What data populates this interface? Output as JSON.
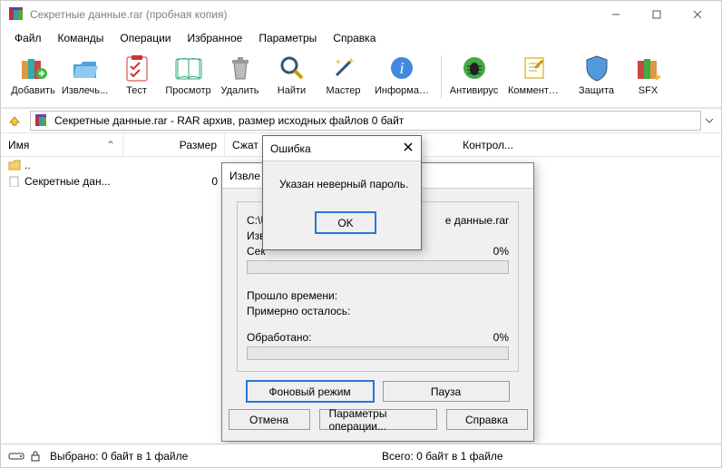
{
  "window": {
    "title": "Секретные данные.rar (пробная копия)"
  },
  "menu": {
    "file": "Файл",
    "commands": "Команды",
    "operations": "Операции",
    "favorites": "Избранное",
    "options": "Параметры",
    "help": "Справка"
  },
  "toolbar": {
    "add": "Добавить",
    "extract": "Извлечь...",
    "test": "Тест",
    "view": "Просмотр",
    "delete": "Удалить",
    "find": "Найти",
    "wizard": "Мастер",
    "info": "Информация",
    "antivirus": "Антивирус",
    "comment": "Комментарий",
    "protect": "Защита",
    "sfx": "SFX"
  },
  "address": {
    "text": "Секретные данные.rar - RAR архив, размер исходных файлов 0 байт"
  },
  "columns": {
    "name": "Имя",
    "size": "Размер",
    "packed": "Сжат",
    "crc": "Контрол..."
  },
  "rows": {
    "updir": "..",
    "file1_name": "Секретные дан...",
    "file1_size": "0"
  },
  "extract_dialog": {
    "title": "Извле",
    "path": "C:\\U",
    "line2_prefix": "Изв",
    "line3_prefix": "Сек",
    "path_tail": "е данные.rar",
    "percent1": "0%",
    "elapsed": "Прошло времени:",
    "remaining": "Примерно осталось:",
    "processed": "Обработано:",
    "percent2": "0%",
    "btn_background": "Фоновый режим",
    "btn_pause": "Пауза",
    "btn_cancel": "Отмена",
    "btn_mode": "Параметры операции...",
    "btn_help": "Справка"
  },
  "error_dialog": {
    "title": "Ошибка",
    "message": "Указан неверный пароль.",
    "ok": "OK"
  },
  "status": {
    "left": "Выбрано: 0 байт в 1 файле",
    "right": "Всего: 0 байт в 1 файле"
  }
}
